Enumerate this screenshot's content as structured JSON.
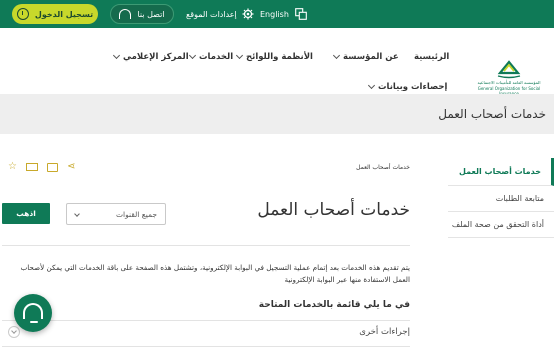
{
  "topbar": {
    "login_label": "تسجيل الدخول",
    "contact_label": "اتصل بنا",
    "settings_label": "إعدادات الموقع",
    "language_label": "English"
  },
  "nav": {
    "items": [
      {
        "label": "الرئيسية"
      },
      {
        "label": "عن المؤسسة"
      },
      {
        "label": "الأنظمة واللوائح"
      },
      {
        "label": "الخدمات"
      },
      {
        "label": "المركز الإعلامي"
      },
      {
        "label": "إحصاءات وبيانات"
      }
    ],
    "logo_line1": "المؤسسة العامة للتأمينات الاجتماعية",
    "logo_line2": "General Organization for Social Insurance"
  },
  "band": {
    "title": "خدمات أصحاب العمل"
  },
  "sidebar": {
    "items": [
      {
        "label": "خدمات أصحاب العمل",
        "active": true
      },
      {
        "label": "متابعة الطلبات",
        "active": false
      },
      {
        "label": "أداة التحقق من صحة الملف",
        "active": false
      }
    ]
  },
  "content": {
    "breadcrumb": "خدمات أصحاب العمل",
    "title": "خدمات أصحاب العمل",
    "select_value": "جميع القنوات",
    "go_label": "اذهب",
    "description": "يتم تقديم هذه الخدمات بعد إتمام عملية التسجيل في البوابة الإلكترونية، وتشتمل هذه الصفحة على باقة الخدمات التي يمكن لأصحاب العمل الاستفادة منها عبر البوابة الإلكترونية",
    "list_title": "في ما يلي قائمة بالخدمات المتاحة",
    "rows": [
      {
        "label": "إجراءات أخرى"
      }
    ]
  },
  "colors": {
    "primary": "#0f7a57",
    "accent": "#c8d82b",
    "icon_gold": "#c8a92b"
  }
}
